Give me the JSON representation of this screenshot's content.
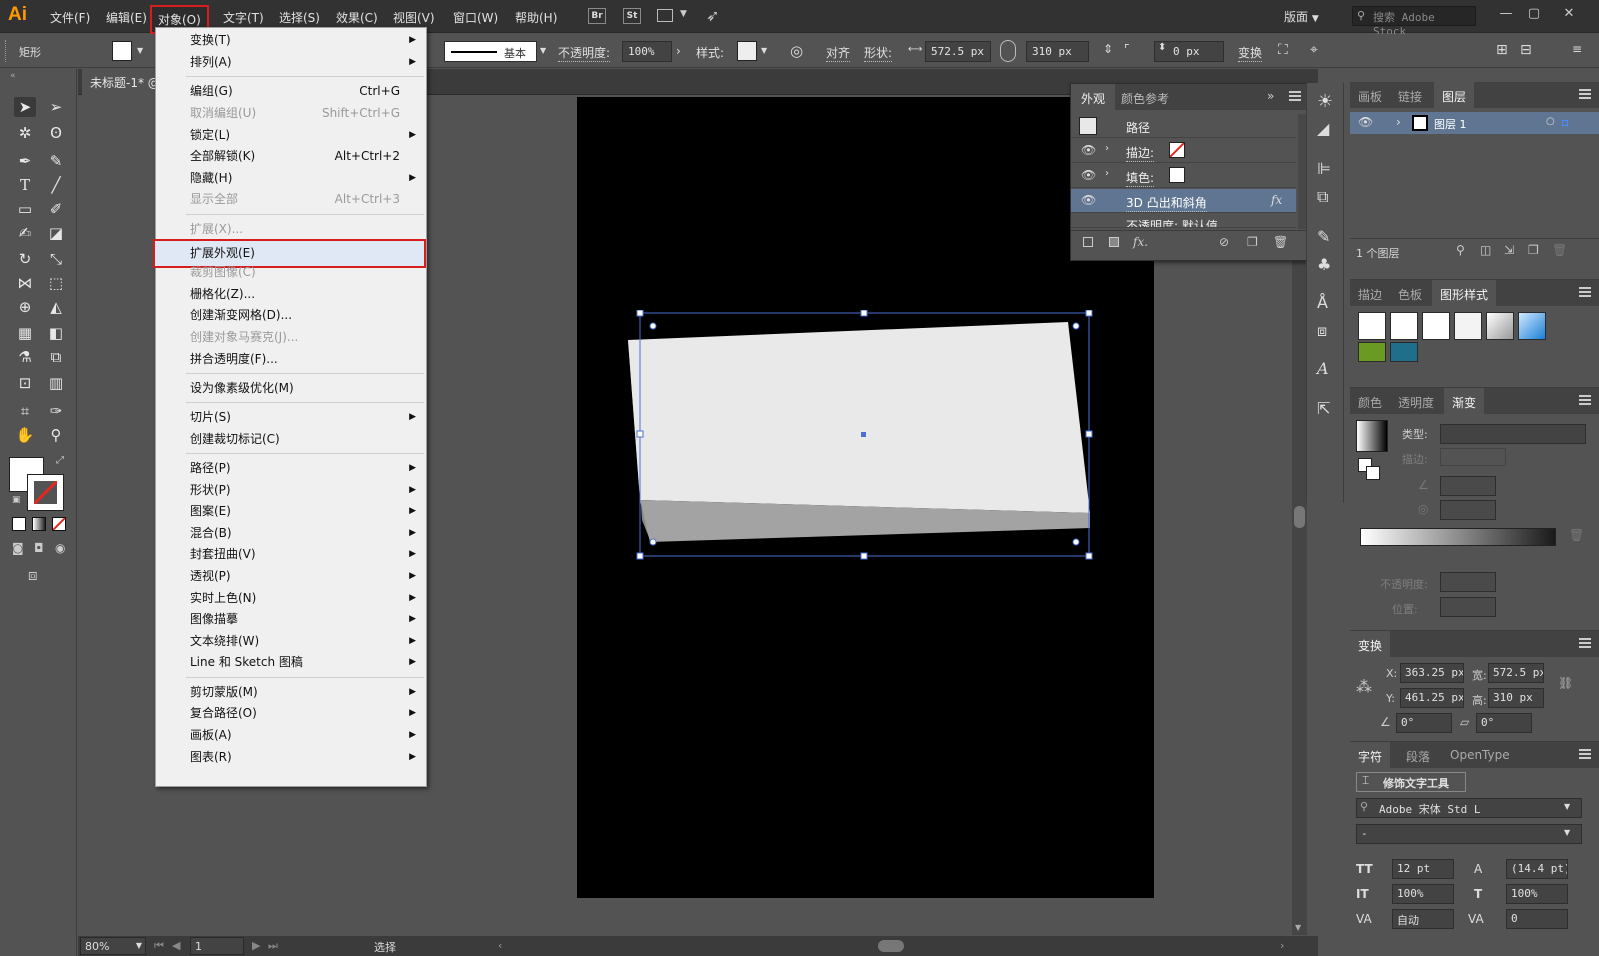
{
  "app": {
    "logo": "Ai",
    "workspace": "版面",
    "stock_placeholder": "搜索 Adobe Stock"
  },
  "menubar": {
    "items": [
      "文件(F)",
      "编辑(E)",
      "对象(O)",
      "文字(T)",
      "选择(S)",
      "效果(C)",
      "视图(V)",
      "窗口(W)",
      "帮助(H)"
    ],
    "active": "对象(O)",
    "bridge": "Br",
    "stock": "St"
  },
  "control": {
    "tool_name": "矩形",
    "stroke_style": "基本",
    "opacity_label": "不透明度:",
    "opacity": "100%",
    "style_label": "样式:",
    "align_label": "对齐",
    "shape_label": "形状:",
    "width": "572.5 px",
    "height": "310 px",
    "corner": "0 px",
    "transform_label": "变换"
  },
  "document": {
    "tab_title": "未标题-1* @"
  },
  "object_menu": {
    "items": [
      {
        "label": "变换(T)",
        "shortcut": "",
        "submenu": true,
        "disabled": false
      },
      {
        "label": "排列(A)",
        "shortcut": "",
        "submenu": true,
        "disabled": false
      },
      {
        "label": "编组(G)",
        "shortcut": "Ctrl+G",
        "submenu": false,
        "disabled": false
      },
      {
        "label": "取消编组(U)",
        "shortcut": "Shift+Ctrl+G",
        "submenu": false,
        "disabled": true
      },
      {
        "label": "锁定(L)",
        "shortcut": "",
        "submenu": true,
        "disabled": false
      },
      {
        "label": "全部解锁(K)",
        "shortcut": "Alt+Ctrl+2",
        "submenu": false,
        "disabled": false
      },
      {
        "label": "隐藏(H)",
        "shortcut": "",
        "submenu": true,
        "disabled": false
      },
      {
        "label": "显示全部",
        "shortcut": "Alt+Ctrl+3",
        "submenu": false,
        "disabled": true
      },
      {
        "label": "扩展(X)...",
        "shortcut": "",
        "submenu": false,
        "disabled": true
      },
      {
        "label": "扩展外观(E)",
        "shortcut": "",
        "submenu": false,
        "disabled": false
      },
      {
        "label": "裁剪图像(C)",
        "shortcut": "",
        "submenu": false,
        "disabled": true
      },
      {
        "label": "栅格化(Z)...",
        "shortcut": "",
        "submenu": false,
        "disabled": false
      },
      {
        "label": "创建渐变网格(D)...",
        "shortcut": "",
        "submenu": false,
        "disabled": false
      },
      {
        "label": "创建对象马赛克(J)...",
        "shortcut": "",
        "submenu": false,
        "disabled": true
      },
      {
        "label": "拼合透明度(F)...",
        "shortcut": "",
        "submenu": false,
        "disabled": false
      },
      {
        "label": "设为像素级优化(M)",
        "shortcut": "",
        "submenu": false,
        "disabled": false
      },
      {
        "label": "切片(S)",
        "shortcut": "",
        "submenu": true,
        "disabled": false
      },
      {
        "label": "创建裁切标记(C)",
        "shortcut": "",
        "submenu": false,
        "disabled": false
      },
      {
        "label": "路径(P)",
        "shortcut": "",
        "submenu": true,
        "disabled": false
      },
      {
        "label": "形状(P)",
        "shortcut": "",
        "submenu": true,
        "disabled": false
      },
      {
        "label": "图案(E)",
        "shortcut": "",
        "submenu": true,
        "disabled": false
      },
      {
        "label": "混合(B)",
        "shortcut": "",
        "submenu": true,
        "disabled": false
      },
      {
        "label": "封套扭曲(V)",
        "shortcut": "",
        "submenu": true,
        "disabled": false
      },
      {
        "label": "透视(P)",
        "shortcut": "",
        "submenu": true,
        "disabled": false
      },
      {
        "label": "实时上色(N)",
        "shortcut": "",
        "submenu": true,
        "disabled": false
      },
      {
        "label": "图像描摹",
        "shortcut": "",
        "submenu": true,
        "disabled": false
      },
      {
        "label": "文本绕排(W)",
        "shortcut": "",
        "submenu": true,
        "disabled": false
      },
      {
        "label": "Line 和 Sketch 图稿",
        "shortcut": "",
        "submenu": true,
        "disabled": false
      },
      {
        "label": "剪切蒙版(M)",
        "shortcut": "",
        "submenu": true,
        "disabled": false
      },
      {
        "label": "复合路径(O)",
        "shortcut": "",
        "submenu": true,
        "disabled": false
      },
      {
        "label": "画板(A)",
        "shortcut": "",
        "submenu": true,
        "disabled": false
      },
      {
        "label": "图表(R)",
        "shortcut": "",
        "submenu": true,
        "disabled": false
      }
    ],
    "highlighted": "扩展外观(E)"
  },
  "appearance_panel": {
    "tabs": [
      "外观",
      "颜色参考"
    ],
    "object": "路径",
    "rows": [
      "描边:",
      "填色:",
      "3D 凸出和斜角",
      "不透明度: 默认值"
    ],
    "fx": "fx"
  },
  "layers_panel": {
    "tabs": [
      "画板",
      "链接",
      "图层"
    ],
    "layer_name": "图层 1",
    "footer": "1 个图层"
  },
  "swatch_panel": {
    "tabs": [
      "描边",
      "色板",
      "图形样式"
    ]
  },
  "gradient_panel": {
    "tabs": [
      "颜色",
      "透明度",
      "渐变"
    ],
    "type_label": "类型:",
    "stroke_label": "描边:",
    "opacity_label": "不透明度:",
    "position_label": "位置:"
  },
  "transform_panel": {
    "title": "变换",
    "x": "363.25 px",
    "y": "461.25 px",
    "w": "572.5 px",
    "h": "310 px",
    "x_label": "X:",
    "y_label": "Y:",
    "w_label": "宽:",
    "h_label": "高:",
    "angle": "0°",
    "shear": "0°"
  },
  "character_panel": {
    "tabs": [
      "字符",
      "段落",
      "OpenType"
    ],
    "touch_tool": "修饰文字工具",
    "font": "Adobe 宋体 Std L",
    "style": "-",
    "size": "12 pt",
    "leading": "(14.4 pt)",
    "vscale": "100%",
    "hscale": "100%",
    "tracking": "自动",
    "kerning": "0"
  },
  "status": {
    "zoom": "80%",
    "page": "1",
    "tool": "选择"
  }
}
